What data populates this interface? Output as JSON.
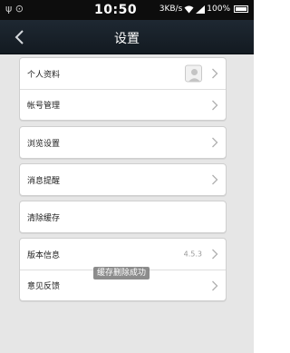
{
  "status_bar": {
    "left_icons": "ψ ⊙",
    "time": "10:50",
    "speed": "3KB/s",
    "battery": "100%"
  },
  "nav": {
    "title": "设置"
  },
  "groups": {
    "profile": {
      "personal_info": "个人资料",
      "account_manage": "帐号管理"
    },
    "browse": {
      "label": "浏览设置"
    },
    "notify": {
      "label": "消息提醒"
    },
    "cache": {
      "label": "清除缓存"
    },
    "about": {
      "version_label": "版本信息",
      "version_value": "4.5.3",
      "feedback_label": "意见反馈"
    }
  },
  "toast": {
    "text": "缓存删除成功"
  },
  "icons": {
    "back": "chevron-left-icon",
    "chevron": "chevron-right-icon",
    "avatar": "avatar-placeholder-icon",
    "wifi": "wifi-icon",
    "signal": "signal-icon",
    "battery": "battery-icon"
  },
  "colors": {
    "navbar": "#1a232c",
    "background": "#e6e6e6",
    "card": "#ffffff",
    "toast": "#787878"
  }
}
